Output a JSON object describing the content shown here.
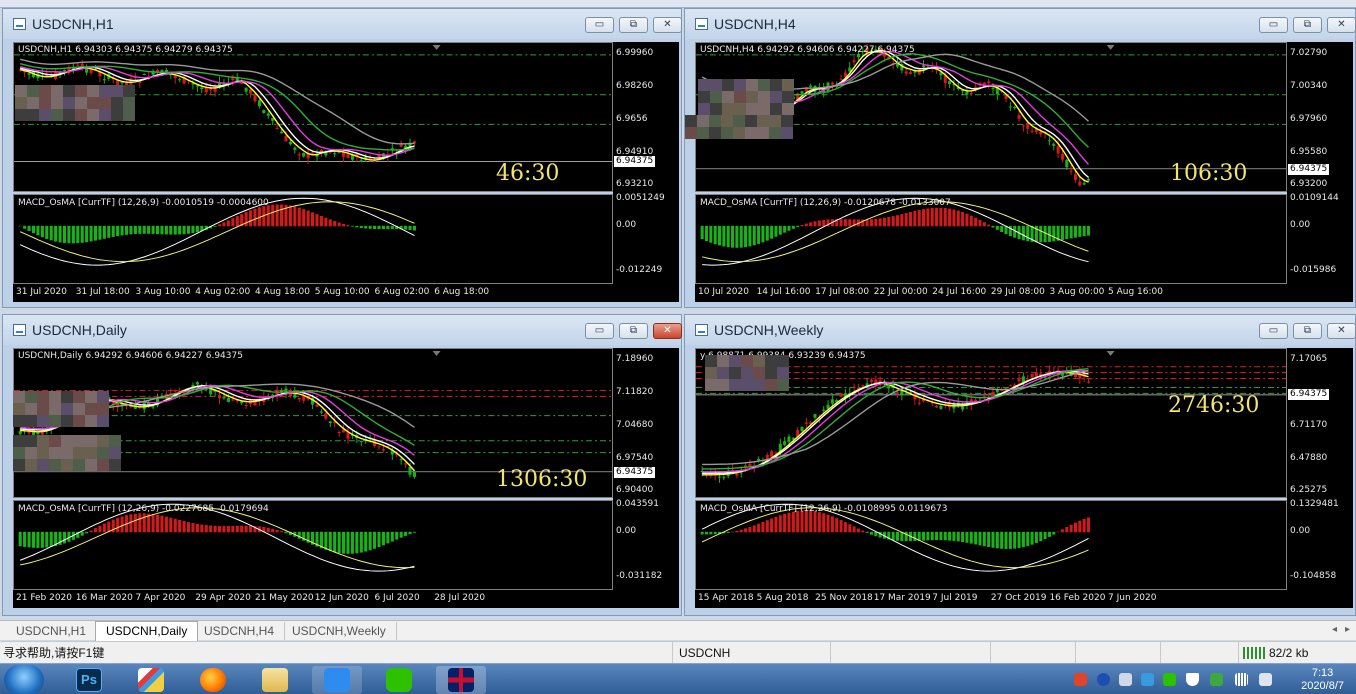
{
  "windows": [
    {
      "id": "h1",
      "title": "USDCNH,H1",
      "info": "USDCNH,H1  6.94303 6.94375 6.94279 6.94375",
      "macd": "MACD_OsMA [CurrTF] (12,26,9) -0.0010519 -0.0004600",
      "price_ticks": [
        "6.99960",
        "6.98260",
        "6.9656",
        "6.94910",
        "6.93210"
      ],
      "current_price": "6.94375",
      "macd_ticks": [
        "0.0051249",
        "0.00",
        "-0.012249"
      ],
      "x_ticks": [
        "31 Jul 2020",
        "31 Jul 18:00",
        "3 Aug 10:00",
        "4 Aug 02:00",
        "4 Aug 18:00",
        "5 Aug 10:00",
        "6 Aug 02:00",
        "6 Aug 18:00"
      ],
      "countdown": "46:30"
    },
    {
      "id": "h4",
      "title": "USDCNH,H4",
      "info": "USDCNH,H4  6.94292 6.94606 6.94227 6.94375",
      "macd": "MACD_OsMA [CurrTF] (12,26,9) -0.0120678 -0.0133007",
      "price_ticks": [
        "7.02790",
        "7.00340",
        "6.97960",
        "6.95580",
        "6.93200"
      ],
      "current_price": "6.94375",
      "macd_ticks": [
        "0.0109144",
        "0.00",
        "-0.015986"
      ],
      "x_ticks": [
        "10 Jul 2020",
        "14 Jul 16:00",
        "17 Jul 08:00",
        "22 Jul 00:00",
        "24 Jul 16:00",
        "29 Jul 08:00",
        "3 Aug 00:00",
        "5 Aug 16:00"
      ],
      "countdown": "106:30"
    },
    {
      "id": "daily",
      "title": "USDCNH,Daily",
      "info": "USDCNH,Daily  6.94292 6.94606 6.94227 6.94375",
      "macd": "MACD_OsMA [CurrTF] (12,26,9) -0.0227685 -0.0179694",
      "price_ticks": [
        "7.18960",
        "7.11820",
        "7.04680",
        "6.97540",
        "6.90400"
      ],
      "current_price": "6.94375",
      "macd_ticks": [
        "0.043591",
        "0.00",
        "-0.031182"
      ],
      "x_ticks": [
        "21 Feb 2020",
        "16 Mar 2020",
        "7 Apr 2020",
        "29 Apr 2020",
        "21 May 2020",
        "12 Jun 2020",
        "6 Jul 2020",
        "28 Jul 2020"
      ],
      "countdown": "1306:30"
    },
    {
      "id": "weekly",
      "title": "USDCNH,Weekly",
      "info": "y  6.98871 6.99384 6.93239 6.94375",
      "macd": "MACD_OsMA [CurrTF] (12,26,9) -0.0108995 0.0119673",
      "price_ticks": [
        "7.17065",
        "6.94375",
        "6.71170",
        "6.47880",
        "6.25275"
      ],
      "current_price": "6.94375",
      "macd_ticks": [
        "0.1329481",
        "0.00",
        "-0.104858"
      ],
      "x_ticks": [
        "15 Apr 2018",
        "5 Aug 2018",
        "25 Nov 2018",
        "17 Mar 2019",
        "7 Jul 2019",
        "27 Oct 2019",
        "16 Feb 2020",
        "7 Jun 2020"
      ],
      "countdown": "2746:30"
    }
  ],
  "window_controls": {
    "minimize": "▭",
    "restore": "⧉",
    "close": "✕"
  },
  "tabs": [
    "USDCNH,H1",
    "USDCNH,Daily",
    "USDCNH,H4",
    "USDCNH,Weekly"
  ],
  "active_tab": "USDCNH,Daily",
  "tab_nav": {
    "left": "◂",
    "right": "▸"
  },
  "status": {
    "help": "寻求帮助,请按F1键",
    "symbol": "USDCNH",
    "traffic": "82/2 kb"
  },
  "clock": {
    "time": "7:13",
    "date": "2020/8/7"
  },
  "colors": {
    "chart_bg": "#000000",
    "bull_candle": "#19b319",
    "bear_candle": "#d21a1a",
    "ma_fast": "#ffff33",
    "ma_mid": "#ffffff",
    "ma_magenta": "#e63be6",
    "ma_green": "#30b030",
    "ma_gray": "#9a9a9a",
    "countdown": "#f3e56a",
    "level_red": "#dd2222",
    "level_green": "#2fa02f"
  },
  "taskbar": [
    "windows-start",
    "photoshop",
    "paint",
    "firefox",
    "file-manager",
    "pen-app",
    "wechat",
    "uk-flag-app"
  ]
}
